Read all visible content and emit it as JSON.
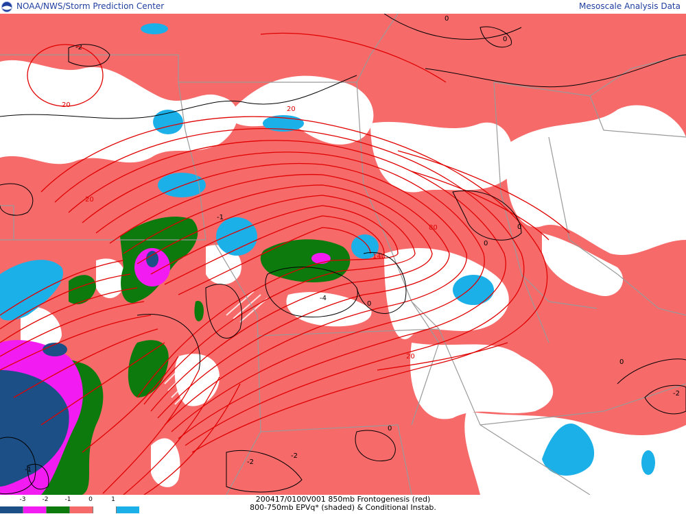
{
  "header": {
    "left_title": "NOAA/NWS/Storm Prediction Center",
    "right_title": "Mesoscale Analysis Data",
    "logo_icon": "noaa-logo-icon"
  },
  "colors": {
    "epv_ge1": "#1cb0e8",
    "epv_0_to_1": "#ffffff",
    "epv_m1_to_0": "#f66a6a",
    "epv_m2_to_m1": "#0c7a0c",
    "epv_m3_to_m2": "#f21cf2",
    "epv_le_m3": "#1c4f86",
    "frontogenesis_contour": "#e00000",
    "instability_contour": "#000000",
    "borders": "#9a9a9a"
  },
  "map_labels": {
    "fronto_20_nw": "20",
    "fronto_20_n": "20",
    "fronto_20_w": "20",
    "fronto_20_se": "20",
    "fronto_80": "80",
    "fronto_140": "140",
    "inst_m2_nw": "-2",
    "inst_0_ne": "0",
    "inst_0_ne2": "0",
    "inst_0_e": "0",
    "inst_0_e2": "0",
    "inst_0_c": "0",
    "inst_m4": "-4",
    "inst_0_s": "0",
    "inst_m2_s": "-2",
    "inst_m2_s2": "-2",
    "inst_0_far_e": "0",
    "inst_m2_far_e": "-2",
    "inst_m1_w": "-1",
    "inst_m1_sw": "-1"
  },
  "legend": {
    "ticks": [
      "-3",
      "-2",
      "-1",
      "0",
      "1"
    ],
    "swatch_colors": [
      "#1c4f86",
      "#f21cf2",
      "#0c7a0c",
      "#f66a6a",
      "#ffffff",
      "#1cb0e8"
    ]
  },
  "caption": {
    "line1": "200417/0100V001 850mb Frontogenesis (red)",
    "line2": "800-750mb EPVq* (shaded) & Conditional Instab."
  }
}
